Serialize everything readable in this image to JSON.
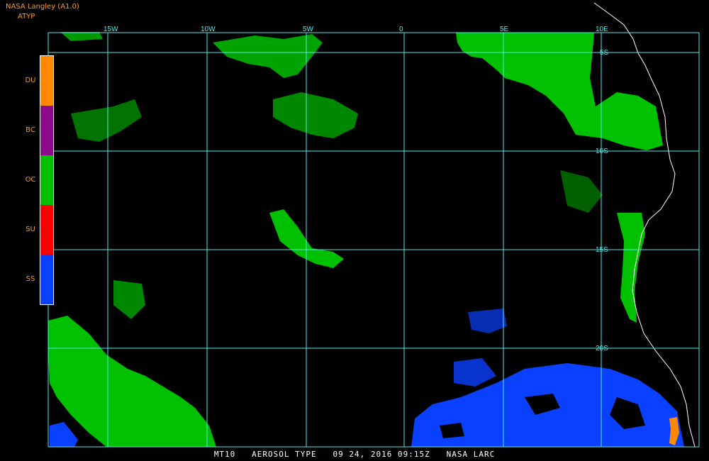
{
  "header": {
    "title": "NASA Langley (A1.0)",
    "subtitle": "ATYP"
  },
  "legend": [
    {
      "code": "DU",
      "color": "#ff8a00"
    },
    {
      "code": "BC",
      "color": "#8a0a8a"
    },
    {
      "code": "OC",
      "color": "#00c000"
    },
    {
      "code": "SU",
      "color": "#ff0000"
    },
    {
      "code": "SS",
      "color": "#0a40ff"
    }
  ],
  "grid": {
    "lon_labels": [
      "15W",
      "10W",
      "5W",
      "0",
      "5E",
      "10E"
    ],
    "lat_labels": [
      "5S",
      "10S",
      "15S",
      "20S"
    ],
    "color": "#55e8e8"
  },
  "footer": "MT10   AEROSOL TYPE   09 24, 2016 09:15Z   NASA LARC"
}
